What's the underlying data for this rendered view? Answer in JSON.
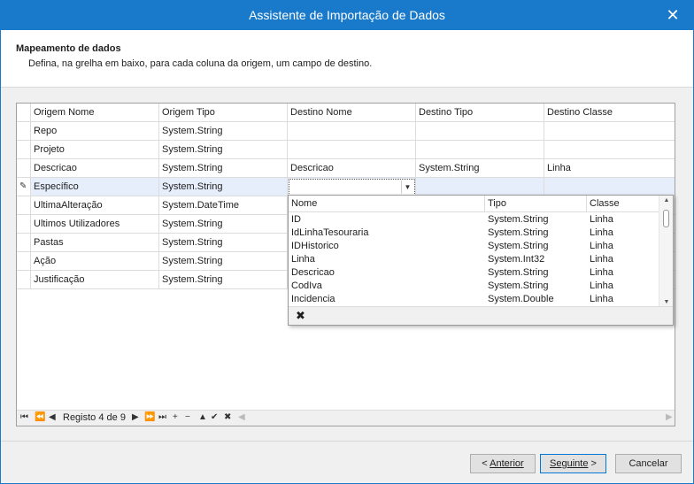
{
  "window": {
    "title": "Assistente de Importação de Dados",
    "close_glyph": "✕"
  },
  "header": {
    "title": "Mapeamento de dados",
    "subtitle": "Defina, na grelha em baixo, para cada coluna da origem, um campo de destino."
  },
  "grid": {
    "columns": [
      "Origem Nome",
      "Origem Tipo",
      "Destino Nome",
      "Destino Tipo",
      "Destino Classe"
    ],
    "rows": [
      [
        "Repo",
        "System.String",
        "",
        "",
        ""
      ],
      [
        "Projeto",
        "System.String",
        "",
        "",
        ""
      ],
      [
        "Descricao",
        "System.String",
        "Descricao",
        "System.String",
        "Linha"
      ],
      [
        "Específico",
        "System.String",
        "",
        "",
        ""
      ],
      [
        "UltimaAlteração",
        "System.DateTime",
        "",
        "",
        ""
      ],
      [
        "Ultimos Utilizadores",
        "System.String",
        "",
        "",
        ""
      ],
      [
        "Pastas",
        "System.String",
        "",
        "",
        ""
      ],
      [
        "Ação",
        "System.String",
        "",
        "",
        ""
      ],
      [
        "Justificação",
        "System.String",
        "",
        "",
        ""
      ]
    ],
    "selected_row": 3,
    "edit_indicator_icon": "pencil-icon"
  },
  "navigator": {
    "record_label": "Registo 4 de 9",
    "buttons": [
      "first",
      "prev-page",
      "prev",
      "next",
      "next-page",
      "last",
      "append",
      "delete",
      "edit",
      "end-edit",
      "cancel-edit"
    ]
  },
  "dropdown": {
    "columns": [
      "Nome",
      "Tipo",
      "Classe"
    ],
    "items": [
      [
        "ID",
        "System.String",
        "Linha"
      ],
      [
        "IdLinhaTesouraria",
        "System.String",
        "Linha"
      ],
      [
        "IDHistorico",
        "System.String",
        "Linha"
      ],
      [
        "Linha",
        "System.Int32",
        "Linha"
      ],
      [
        "Descricao",
        "System.String",
        "Linha"
      ],
      [
        "CodIva",
        "System.String",
        "Linha"
      ],
      [
        "Incidencia",
        "System.Double",
        "Linha"
      ]
    ],
    "clear_glyph": "✖"
  },
  "buttons": {
    "prev_prefix": "< ",
    "prev_label": "Anterior",
    "next_label": "Seguinte",
    "next_suffix": " >",
    "cancel_label": "Cancelar"
  }
}
